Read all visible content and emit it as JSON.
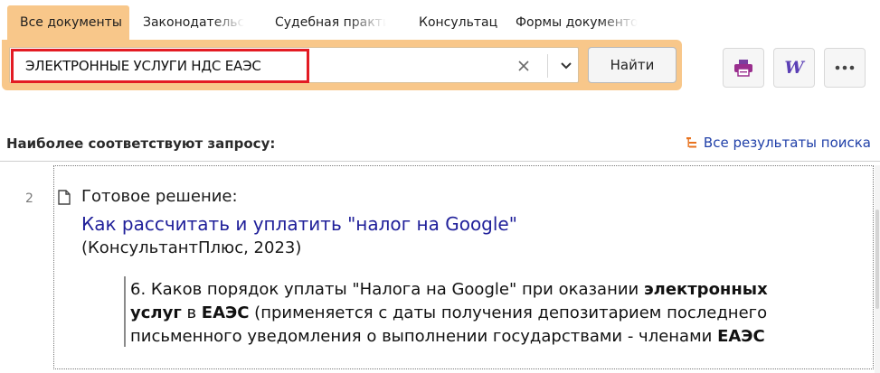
{
  "tabs": [
    {
      "label": "Все документы",
      "active": true
    },
    {
      "label": "Законодательство",
      "active": false
    },
    {
      "label": "Судебная практика",
      "active": false
    },
    {
      "label": "Консультации",
      "active": false
    },
    {
      "label": "Формы документов",
      "active": false
    }
  ],
  "search": {
    "query": "ЭЛЕКТРОННЫЕ УСЛУГИ НДС ЕАЭС",
    "clear_icon": "close-icon",
    "dropdown_icon": "chevron-down-icon",
    "find_label": "Найти"
  },
  "toolbar": {
    "print_icon": "printer-icon",
    "word_icon": "word-icon",
    "word_glyph": "W",
    "more_icon": "more-icon"
  },
  "results": {
    "title": "Наиболее соответствуют запросу:",
    "all_results_label": "Все результаты поиска",
    "all_results_icon": "tree-list-icon",
    "items": [
      {
        "number": "2",
        "doc_icon": "document-icon",
        "type": "Готовое решение:",
        "title": "Как рассчитать и уплатить \"налог на Google\"",
        "source": "(КонсультантПлюс, 2023)",
        "excerpt": {
          "line1_a": "6. Каков порядок уплаты \"Налога на Google\" при оказании ",
          "line1_b": "электронных",
          "line2_a": "услуг",
          "line2_b": " в ",
          "line2_c": "ЕАЭС",
          "line2_d": " (применяется с даты получения депозитарием последнего",
          "line3_a": "письменного уведомления о выполнении государствами - членами ",
          "line3_b": "ЕАЭС"
        }
      }
    ]
  },
  "colors": {
    "panel_orange": "#f8c78a",
    "highlight_red": "#e31b23",
    "link_blue": "#20209a",
    "accent_blue": "#1f3fa8",
    "icon_orange": "#e8731f",
    "word_purple": "#5b3fb5"
  }
}
